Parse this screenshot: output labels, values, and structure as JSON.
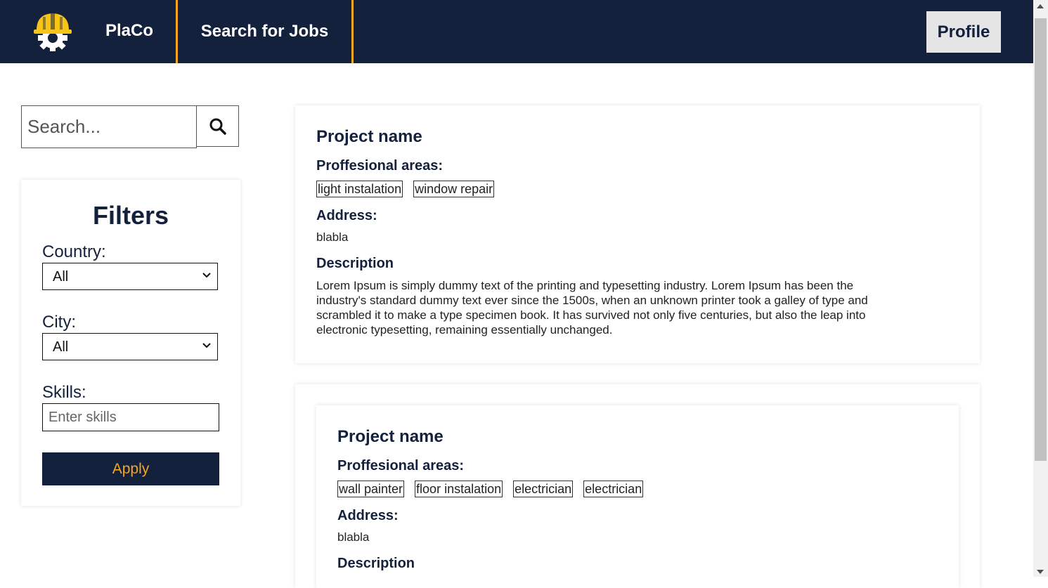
{
  "navbar": {
    "logo_name": "helmet-gear-logo",
    "brand": "PlaCo",
    "jobs_link": "Search for Jobs",
    "profile_label": "Profile",
    "accent": "#f5a524",
    "background": "#14213d"
  },
  "search": {
    "placeholder": "Search...",
    "button_icon": "search-icon"
  },
  "filters": {
    "title": "Filters",
    "country_label": "Country:",
    "country_value": "All",
    "city_label": "City:",
    "city_value": "All",
    "skills_label": "Skills:",
    "skills_placeholder": "Enter skills",
    "apply_label": "Apply"
  },
  "projects": [
    {
      "name": "Project name",
      "areas_label": "Proffesional areas:",
      "areas": [
        "light instalation",
        "window repair"
      ],
      "address_label": "Address:",
      "address": "blabla",
      "description_label": "Description",
      "description_lines": [
        "Lorem Ipsum is simply dummy text of the printing and typesetting industry. Lorem Ipsum has been the",
        "industry's standard dummy text ever since the 1500s, when an unknown printer took a galley of type and",
        "scrambled it to make a type specimen book. It has survived not only five centuries, but also the leap into",
        "electronic typesetting, remaining essentially unchanged."
      ]
    },
    {
      "name": "Project name",
      "areas_label": "Proffesional areas:",
      "areas": [
        "wall painter",
        "floor instalation",
        "electrician",
        "electrician"
      ],
      "address_label": "Address:",
      "address": "blabla",
      "description_label": "Description"
    }
  ]
}
